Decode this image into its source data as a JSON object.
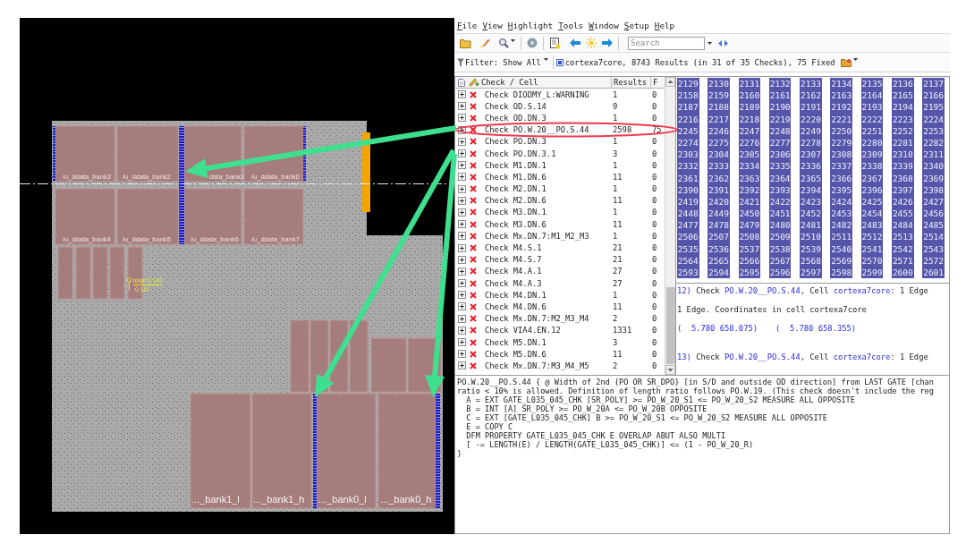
{
  "layout_view": {
    "cell_labels": [
      "/u_ddata_bank3",
      "/u_ddata_bank2",
      "data_bank1",
      "/u_ddata_bank0",
      "/u_ddata_bank4",
      "/u_ddata_bank5",
      "/u_ddata_bank6",
      "/u_ddata_bank7"
    ],
    "lower_cell_labels": [
      "..._bank1_l",
      "..._bank1_h",
      "..._bank0_l",
      "..._bank0_h"
    ],
    "measurement": {
      "total": "total=0.140",
      "value": "0.140"
    }
  },
  "menu": [
    "File",
    "View",
    "Highlight",
    "Tools",
    "Window",
    "Setup",
    "Help"
  ],
  "search": {
    "placeholder": "Search"
  },
  "filter": {
    "label": "Filter: Show All",
    "summary": "cortexa7core, 8743 Results (in 31 of 35 Checks), 75 Fixed"
  },
  "checks": {
    "columns": [
      "Check / Cell",
      "Results",
      "F"
    ],
    "rows": [
      {
        "name": "Check DIODMY_L:WARNING",
        "results": "1",
        "fixed": "0",
        "selected": false
      },
      {
        "name": "Check OD.S.14",
        "results": "9",
        "fixed": "0",
        "selected": false
      },
      {
        "name": "Check OD.DN.3",
        "results": "1",
        "fixed": "0",
        "selected": false
      },
      {
        "name": "Check PO.W.20__PO.S.44",
        "results": "2598",
        "fixed": "75",
        "selected": false
      },
      {
        "name": "Check PO.DN.3",
        "results": "1",
        "fixed": "0",
        "selected": false
      },
      {
        "name": "Check PO.DN.3.1",
        "results": "3",
        "fixed": "0",
        "selected": false
      },
      {
        "name": "Check M1.DN.1",
        "results": "1",
        "fixed": "0",
        "selected": false
      },
      {
        "name": "Check M1.DN.6",
        "results": "11",
        "fixed": "0",
        "selected": false
      },
      {
        "name": "Check M2.DN.1",
        "results": "1",
        "fixed": "0",
        "selected": false
      },
      {
        "name": "Check M2.DN.6",
        "results": "11",
        "fixed": "0",
        "selected": false
      },
      {
        "name": "Check M3.DN.1",
        "results": "1",
        "fixed": "0",
        "selected": false
      },
      {
        "name": "Check M3.DN.6",
        "results": "11",
        "fixed": "0",
        "selected": false
      },
      {
        "name": "Check Mx.DN.7:M1_M2_M3",
        "results": "1",
        "fixed": "0",
        "selected": false
      },
      {
        "name": "Check M4.S.1",
        "results": "21",
        "fixed": "0",
        "selected": false
      },
      {
        "name": "Check M4.S.7",
        "results": "21",
        "fixed": "0",
        "selected": false
      },
      {
        "name": "Check M4.A.1",
        "results": "27",
        "fixed": "0",
        "selected": false
      },
      {
        "name": "Check M4.A.3",
        "results": "27",
        "fixed": "0",
        "selected": false
      },
      {
        "name": "Check M4.DN.1",
        "results": "1",
        "fixed": "0",
        "selected": false
      },
      {
        "name": "Check M4.DN.6",
        "results": "11",
        "fixed": "0",
        "selected": false
      },
      {
        "name": "Check Mx.DN.7:M2_M3_M4",
        "results": "2",
        "fixed": "0",
        "selected": false
      },
      {
        "name": "Check VIA4.EN.12",
        "results": "1331",
        "fixed": "0",
        "selected": false
      },
      {
        "name": "Check M5.DN.1",
        "results": "3",
        "fixed": "0",
        "selected": false
      },
      {
        "name": "Check M5.DN.6",
        "results": "11",
        "fixed": "0",
        "selected": false
      },
      {
        "name": "Check Mx.DN.7:M3_M4_M5",
        "results": "2",
        "fixed": "0",
        "selected": false
      }
    ]
  },
  "result_grid": {
    "selected": true,
    "rows": [
      [
        "2129",
        "2130",
        "2131",
        "2132",
        "2133",
        "2134",
        "2135",
        "2136",
        "2137"
      ],
      [
        "2158",
        "2159",
        "2160",
        "2161",
        "2162",
        "2163",
        "2164",
        "2165",
        "2166"
      ],
      [
        "2187",
        "2188",
        "2189",
        "2190",
        "2191",
        "2192",
        "2193",
        "2194",
        "2195"
      ],
      [
        "2216",
        "2217",
        "2218",
        "2219",
        "2220",
        "2221",
        "2222",
        "2223",
        "2224"
      ],
      [
        "2245",
        "2246",
        "2247",
        "2248",
        "2249",
        "2250",
        "2251",
        "2252",
        "2253"
      ],
      [
        "2274",
        "2275",
        "2276",
        "2277",
        "2278",
        "2279",
        "2280",
        "2281",
        "2282"
      ],
      [
        "2303",
        "2304",
        "2305",
        "2306",
        "2307",
        "2308",
        "2309",
        "2310",
        "2311"
      ],
      [
        "2332",
        "2333",
        "2334",
        "2335",
        "2336",
        "2337",
        "2338",
        "2339",
        "2340"
      ],
      [
        "2361",
        "2362",
        "2363",
        "2364",
        "2365",
        "2366",
        "2367",
        "2368",
        "2369"
      ],
      [
        "2390",
        "2391",
        "2392",
        "2393",
        "2394",
        "2395",
        "2396",
        "2397",
        "2398"
      ],
      [
        "2419",
        "2420",
        "2421",
        "2422",
        "2423",
        "2424",
        "2425",
        "2426",
        "2427"
      ],
      [
        "2448",
        "2449",
        "2450",
        "2451",
        "2452",
        "2453",
        "2454",
        "2455",
        "2456"
      ],
      [
        "2477",
        "2478",
        "2479",
        "2480",
        "2481",
        "2482",
        "2483",
        "2484",
        "2485"
      ],
      [
        "2506",
        "2507",
        "2508",
        "2509",
        "2510",
        "2511",
        "2512",
        "2513",
        "2514"
      ],
      [
        "2535",
        "2536",
        "2537",
        "2538",
        "2539",
        "2540",
        "2541",
        "2542",
        "2543"
      ],
      [
        "2564",
        "2565",
        "2566",
        "2567",
        "2568",
        "2569",
        "2570",
        "2571",
        "2572"
      ],
      [
        "2593",
        "2594",
        "2595",
        "2596",
        "2597",
        "2598",
        "2599",
        "2600",
        "2601"
      ]
    ]
  },
  "details": [
    {
      "kind": "heading",
      "parts": [
        {
          "text": "12)",
          "link": true
        },
        {
          "text": " Check ",
          "link": false
        },
        {
          "text": "PO.W.20__PO.S.44",
          "link": true
        },
        {
          "text": ", Cell ",
          "link": false
        },
        {
          "text": "cortexa7core",
          "link": true
        },
        {
          "text": ": 1 Edge",
          "link": false
        }
      ]
    },
    {
      "kind": "text",
      "text": "1 Edge. Coordinates in cell cortexa7core"
    },
    {
      "kind": "coordinates",
      "points": [
        "(  5.780 658.075)",
        "(  5.780 658.355)"
      ]
    },
    {
      "kind": "heading",
      "parts": [
        {
          "text": "13)",
          "link": true
        },
        {
          "text": " Check ",
          "link": false
        },
        {
          "text": "PO.W.20__PO.S.44",
          "link": true
        },
        {
          "text": ", Cell ",
          "link": false
        },
        {
          "text": "cortexa7core",
          "link": true
        },
        {
          "text": ": 1 Edge",
          "link": false
        }
      ]
    }
  ],
  "rule_text": [
    "PO.W.20__PO.S.44 { @ Width of 2nd {PO OR SR_DPO} [in S/D and outside OD direction] from LAST GATE [chan",
    "ratio < 10% is allowed. Definition of length ratio follows PO.W.19. (This check doesn't include the reg",
    "  A = EXT GATE_L035_045_CHK [SR_POLY] >= PO_W_20_S1 <= PO_W_20_S2 MEASURE ALL OPPOSITE",
    "  B = INT [A] SR_POLY >= PO_W_20A <= PO_W_20B OPPOSITE",
    "  C = EXT [GATE_L035_045_CHK] B >= PO_W_20_S1 <= PO_W_20_S2 MEASURE ALL OPPOSITE",
    "  E = COPY C",
    "  DFM PROPERTY GATE_L035_045_CHK E OVERLAP ABUT ALSO MULTI",
    "  [ -= LENGTH(E) / LENGTH(GATE_L035_045_CHK)] <= (1 - PO_W_20_R)",
    "}"
  ]
}
